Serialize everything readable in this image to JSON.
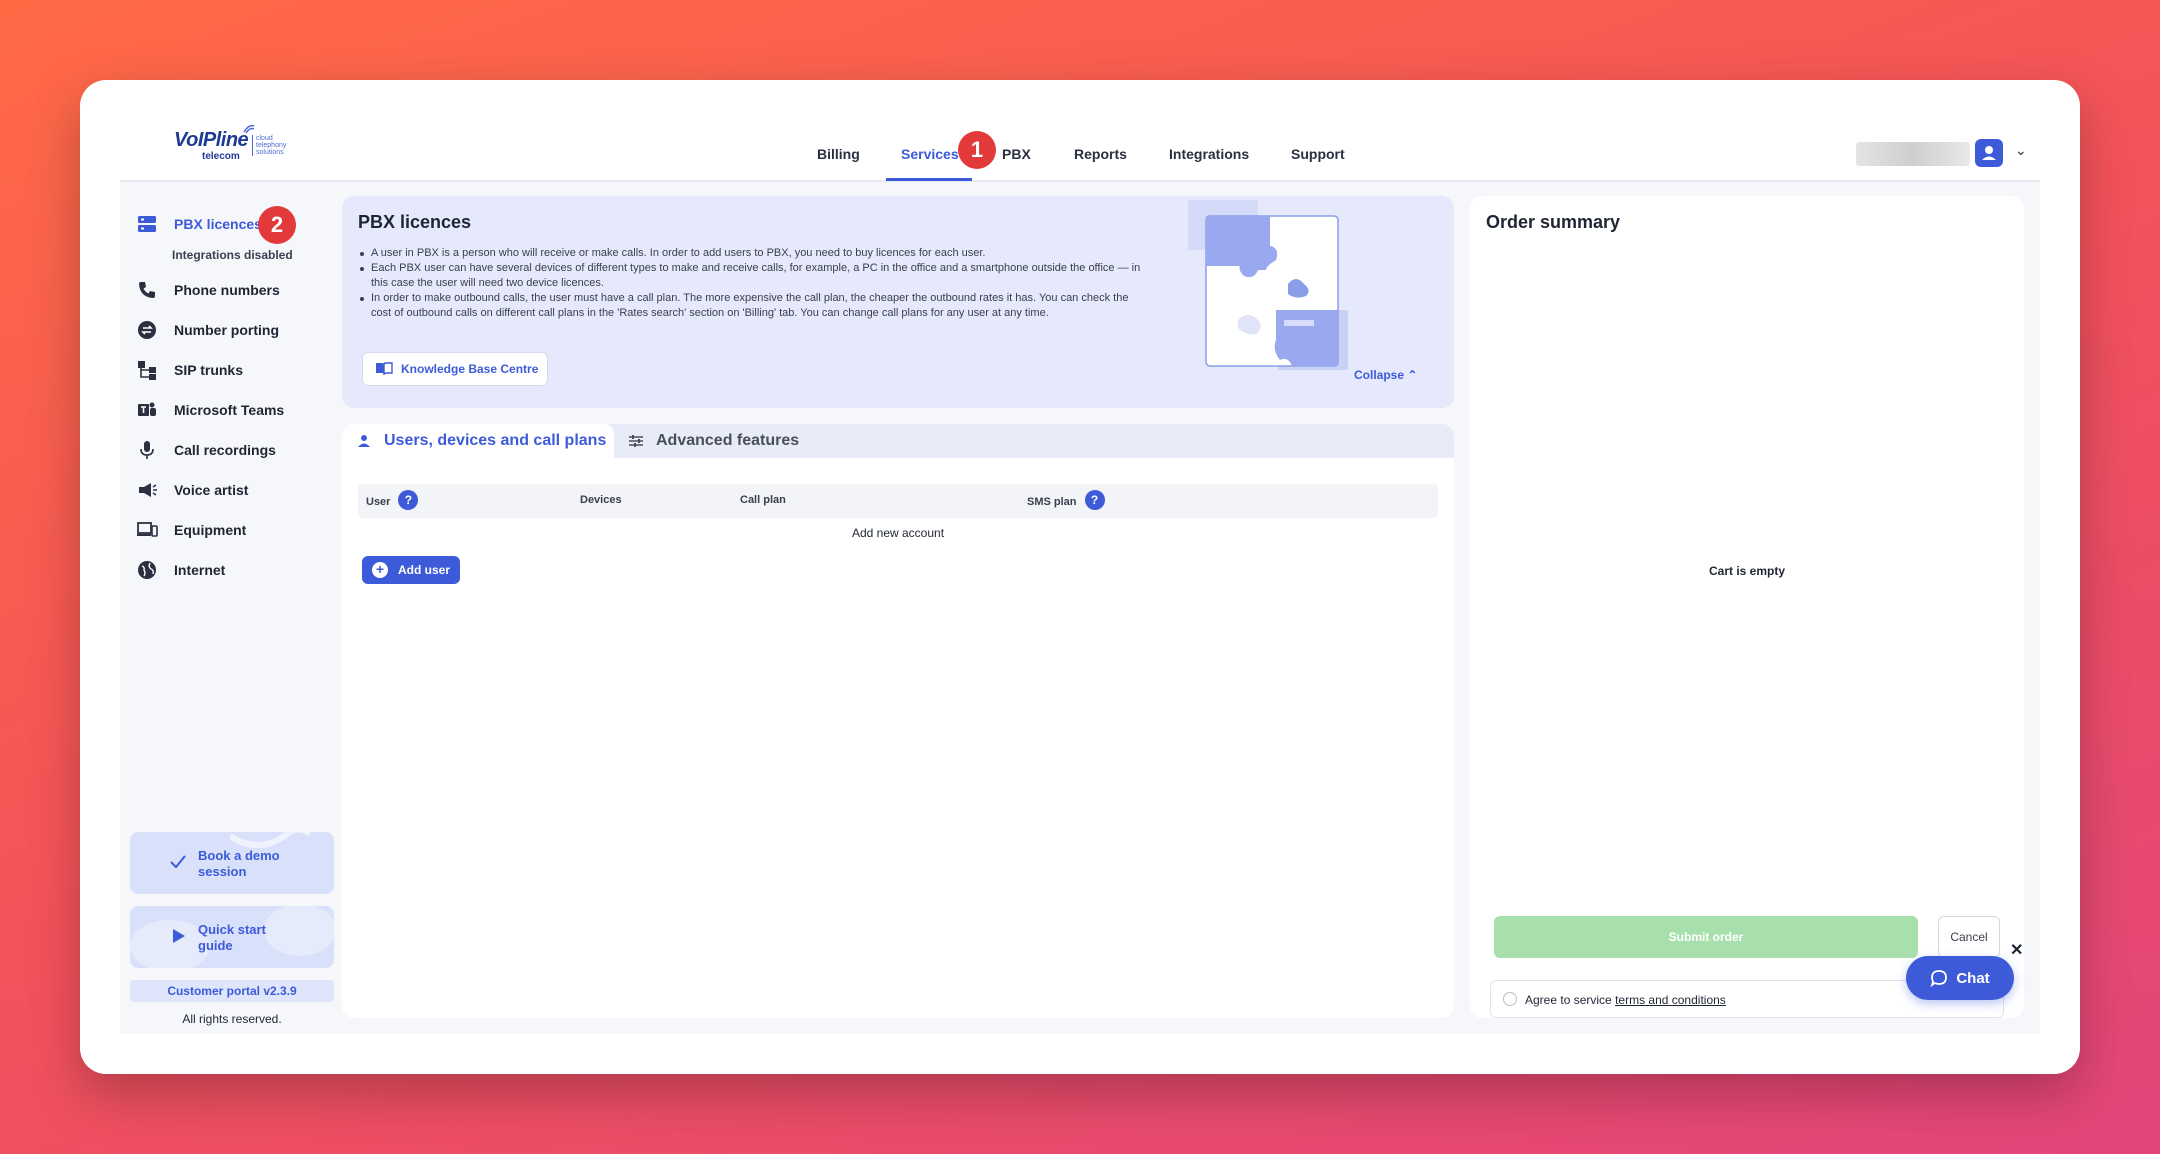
{
  "brand": {
    "name": "VoIPline",
    "sub": "telecom",
    "tagline": [
      "cloud",
      "telephony",
      "solutions"
    ]
  },
  "nav": {
    "items": [
      {
        "label": "Billing"
      },
      {
        "label": "Services"
      },
      {
        "label": "PBX"
      },
      {
        "label": "Reports"
      },
      {
        "label": "Integrations"
      },
      {
        "label": "Support"
      }
    ],
    "active": "Services"
  },
  "badges": {
    "step1": "1",
    "step2": "2"
  },
  "sidebar": {
    "items": [
      {
        "label": "PBX licences",
        "icon": "server-icon"
      },
      {
        "label": "Phone numbers",
        "icon": "phone-icon"
      },
      {
        "label": "Number porting",
        "icon": "porting-icon"
      },
      {
        "label": "SIP trunks",
        "icon": "sip-trunk-icon"
      },
      {
        "label": "Microsoft Teams",
        "icon": "teams-icon"
      },
      {
        "label": "Call recordings",
        "icon": "microphone-icon"
      },
      {
        "label": "Voice artist",
        "icon": "megaphone-icon"
      },
      {
        "label": "Equipment",
        "icon": "devices-icon"
      },
      {
        "label": "Internet",
        "icon": "globe-icon"
      }
    ],
    "note": "Integrations disabled",
    "promo_demo": "Book a demo session",
    "promo_guide": "Quick start guide",
    "version": "Customer portal v2.3.9",
    "rights": "All rights reserved."
  },
  "info": {
    "title": "PBX licences",
    "bullets": [
      "A user in PBX is a person who will receive or make calls. In order to add users to PBX, you need to buy licences for each user.",
      "Each PBX user can have several devices of different types to make and receive calls, for example, a PC in the office and a smartphone outside the office — in this case the user will need two device licences.",
      "In order to make outbound calls, the user must have a call plan. The more expensive the call plan, the cheaper the outbound rates it has. You can check the cost of outbound calls on different call plans in the 'Rates search' section on 'Billing' tab. You can change call plans for any user at any time."
    ],
    "kb_button": "Knowledge Base Centre",
    "collapse": "Collapse"
  },
  "tabs": {
    "active": "Users, devices and call plans",
    "inactive": "Advanced features"
  },
  "table": {
    "headers": [
      "User",
      "Devices",
      "Call plan",
      "SMS plan"
    ],
    "empty": "Add new account",
    "add_user": "Add user"
  },
  "order": {
    "title": "Order summary",
    "empty": "Cart is empty",
    "submit": "Submit order",
    "cancel": "Cancel",
    "agree_prefix": "Agree to service",
    "agree_link": "terms and conditions"
  },
  "chat": {
    "label": "Chat",
    "close": "✕"
  },
  "colors": {
    "accent": "#3d5bd9",
    "badge": "#e23a3a",
    "submit_disabled": "#a8e0ad"
  }
}
